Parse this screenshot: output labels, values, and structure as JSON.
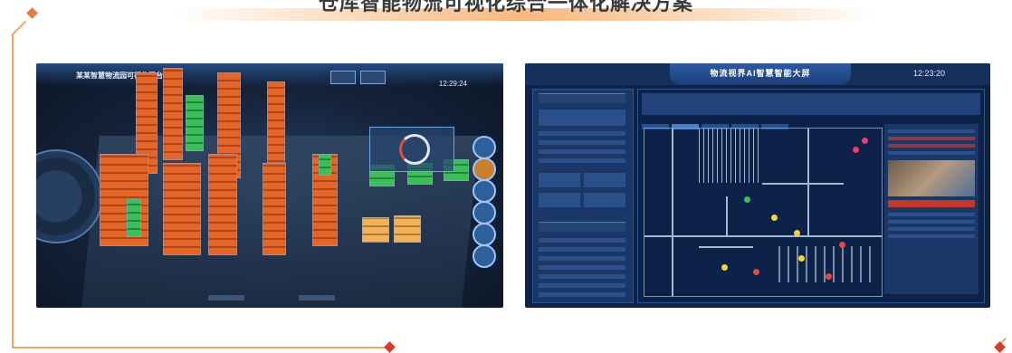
{
  "header": {
    "title": "仓库智能物流可视化综合一体化解决方案"
  },
  "left_panel": {
    "title": "某某智慧物流园可视化平台",
    "time": "12:29:24"
  },
  "right_panel": {
    "title": "物流视界AI智慧智能大屏",
    "time": "12:23:20"
  },
  "colors": {
    "accent_orange": "#f0a36b",
    "marker_red": "#dd3a2f",
    "marker_orange": "#ea7a3b"
  }
}
